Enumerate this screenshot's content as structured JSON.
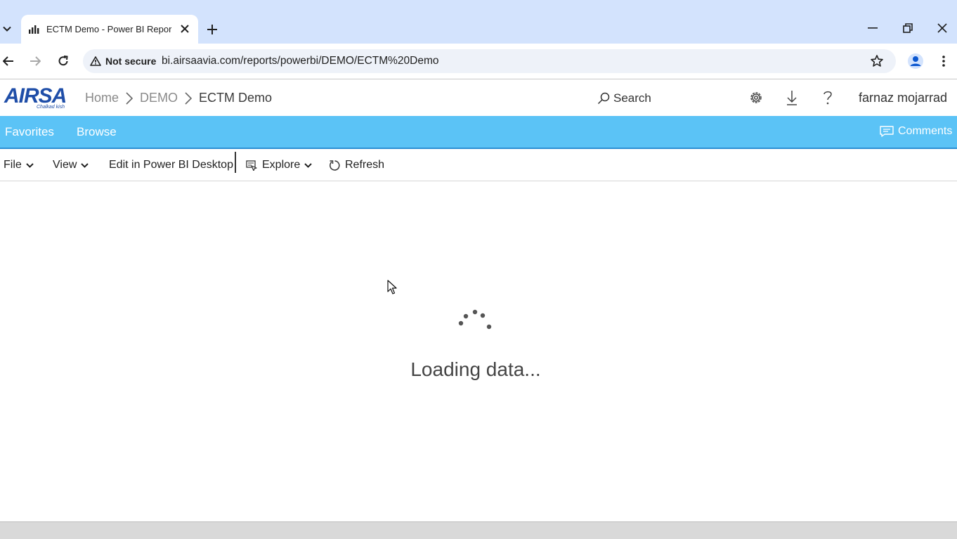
{
  "browser": {
    "tab": {
      "title": "ECTM Demo - Power BI Report",
      "favicon": "bar-chart-icon"
    },
    "address": {
      "security_label": "Not secure",
      "url": "bi.airsaavia.com/reports/powerbi/DEMO/ECTM%20Demo"
    },
    "icons": [
      "tab-list-icon",
      "close-icon",
      "plus-icon",
      "minimize-icon",
      "restore-icon",
      "window-close-icon",
      "back-icon",
      "forward-icon",
      "reload-icon",
      "warning-icon",
      "star-icon",
      "profile-icon",
      "more-vert-icon"
    ]
  },
  "app": {
    "logo": {
      "text": "AIRSA",
      "subtext": "Chalkad kish"
    },
    "breadcrumb": [
      "Home",
      "DEMO",
      "ECTM Demo"
    ],
    "search_label": "Search",
    "user_name": "farnaz mojarrad",
    "icons": [
      "search-icon",
      "gear-icon",
      "download-icon",
      "help-icon"
    ]
  },
  "navbar": {
    "items": [
      "Favorites",
      "Browse"
    ],
    "comments_label": "Comments",
    "color": "#5bc3f6"
  },
  "report_toolbar": {
    "file_label": "File",
    "view_label": "View",
    "edit_label": "Edit in Power BI Desktop",
    "explore_label": "Explore",
    "refresh_label": "Refresh"
  },
  "content": {
    "loading_text": "Loading data..."
  }
}
